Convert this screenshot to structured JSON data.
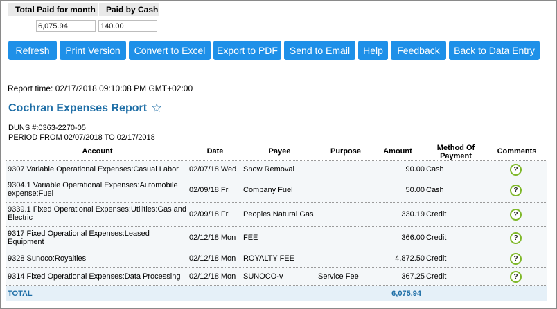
{
  "summary": {
    "total_paid_label": "Total Paid for month",
    "paid_cash_label": "Paid by Cash",
    "total_paid_value": "6,075.94",
    "paid_cash_value": "140.00"
  },
  "buttons": {
    "refresh": "Refresh",
    "print": "Print Version",
    "excel": "Convert to Excel",
    "pdf": "Export to PDF",
    "email": "Send to Email",
    "help": "Help",
    "feedback": "Feedback",
    "back": "Back to Data Entry"
  },
  "report": {
    "time": "Report time: 02/17/2018 09:10:08 PM GMT+02:00",
    "title": "Cochran Expenses Report",
    "star_icon": "☆",
    "duns": "DUNS #:0363-2270-05",
    "period": "PERIOD FROM 02/07/2018 TO 02/17/2018"
  },
  "table": {
    "headers": {
      "account": "Account",
      "date": "Date",
      "payee": "Payee",
      "purpose": "Purpose",
      "amount": "Amount",
      "method": "Method Of Payment",
      "comments": "Comments"
    },
    "rows": [
      {
        "account": "9307 Variable Operational Expenses:Casual Labor",
        "date": "02/07/18 Wed",
        "payee": "Snow Removal",
        "purpose": "",
        "amount": "90.00",
        "method": "Cash"
      },
      {
        "account": "9304.1 Variable Operational Expenses:Automobile expense:Fuel",
        "date": "02/09/18 Fri",
        "payee": "Company Fuel",
        "purpose": "",
        "amount": "50.00",
        "method": "Cash"
      },
      {
        "account": "9339.1 Fixed Operational Expenses:Utilities:Gas and Electric",
        "date": "02/09/18 Fri",
        "payee": "Peoples Natural Gas",
        "purpose": "",
        "amount": "330.19",
        "method": "Credit"
      },
      {
        "account": "9317 Fixed Operational Expenses:Leased Equipment",
        "date": "02/12/18 Mon",
        "payee": "FEE",
        "purpose": "",
        "amount": "366.00",
        "method": "Credit"
      },
      {
        "account": "9328 Sunoco:Royalties",
        "date": "02/12/18 Mon",
        "payee": "ROYALTY FEE",
        "purpose": "",
        "amount": "4,872.50",
        "method": "Credit"
      },
      {
        "account": "9314 Fixed Operational Expenses:Data Processing",
        "date": "02/12/18 Mon",
        "payee": "SUNOCO-v",
        "purpose": "Service Fee",
        "amount": "367.25",
        "method": "Credit"
      }
    ],
    "comment_icon": "?",
    "total_label": "TOTAL",
    "total_amount": "6,075.94"
  }
}
